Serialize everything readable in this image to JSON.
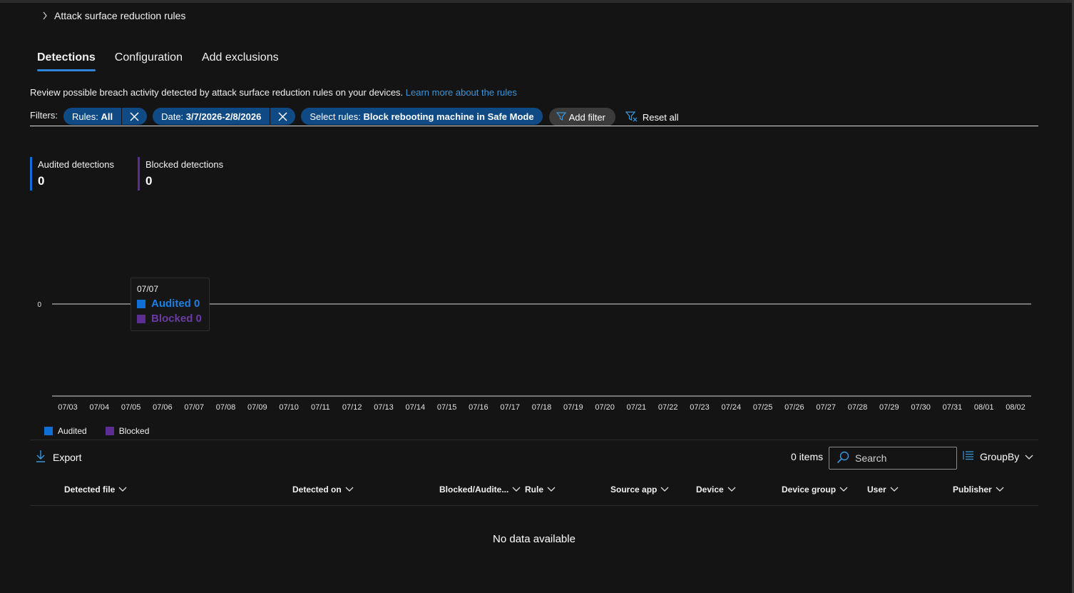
{
  "breadcrumb": {
    "label": "Attack surface reduction rules"
  },
  "tabs": [
    {
      "label": "Detections",
      "active": true
    },
    {
      "label": "Configuration",
      "active": false
    },
    {
      "label": "Add exclusions",
      "active": false
    }
  ],
  "description": {
    "text": "Review possible breach activity detected by attack surface reduction rules on your devices.",
    "link": "Learn more about the rules"
  },
  "filters": {
    "label": "Filters:",
    "pills": [
      {
        "key": "Rules: ",
        "value": "All"
      },
      {
        "key": "Date: ",
        "value": "3/7/2026-2/8/2026"
      },
      {
        "key": "Select rules: ",
        "value": "Block rebooting machine in Safe Mode"
      }
    ],
    "add_filter": "Add filter",
    "reset_all": "Reset all"
  },
  "kpis": {
    "audited": {
      "label": "Audited detections",
      "value": "0"
    },
    "blocked": {
      "label": "Blocked detections",
      "value": "0"
    }
  },
  "colors": {
    "audited": "#0f6fd6",
    "blocked": "#5c2e91",
    "accent": "#2f86d8",
    "pill": "#0f4a85"
  },
  "chart_data": {
    "type": "bar",
    "categories": [
      "07/03",
      "07/04",
      "07/05",
      "07/06",
      "07/07",
      "07/08",
      "07/09",
      "07/10",
      "07/11",
      "07/12",
      "07/13",
      "07/14",
      "07/15",
      "07/16",
      "07/17",
      "07/18",
      "07/19",
      "07/20",
      "07/21",
      "07/22",
      "07/23",
      "07/24",
      "07/25",
      "07/26",
      "07/27",
      "07/28",
      "07/29",
      "07/30",
      "07/31",
      "08/01",
      "08/02"
    ],
    "series": [
      {
        "name": "Audited",
        "values": [
          0,
          0,
          0,
          0,
          0,
          0,
          0,
          0,
          0,
          0,
          0,
          0,
          0,
          0,
          0,
          0,
          0,
          0,
          0,
          0,
          0,
          0,
          0,
          0,
          0,
          0,
          0,
          0,
          0,
          0,
          0
        ]
      },
      {
        "name": "Blocked",
        "values": [
          0,
          0,
          0,
          0,
          0,
          0,
          0,
          0,
          0,
          0,
          0,
          0,
          0,
          0,
          0,
          0,
          0,
          0,
          0,
          0,
          0,
          0,
          0,
          0,
          0,
          0,
          0,
          0,
          0,
          0,
          0
        ]
      }
    ],
    "y_tick": "0",
    "legend": "bottom-left"
  },
  "tooltip": {
    "date": "07/07",
    "audited": "Audited 0",
    "blocked": "Blocked 0"
  },
  "legend": {
    "audited": "Audited",
    "blocked": "Blocked"
  },
  "toolbar": {
    "export": "Export",
    "items": "0 items",
    "search_placeholder": "Search",
    "groupby": "GroupBy"
  },
  "table": {
    "columns": [
      "Detected file",
      "Detected on",
      "Blocked/Audite...",
      "Rule",
      "Source app",
      "Device",
      "Device group",
      "User",
      "Publisher"
    ],
    "empty": "No data available"
  }
}
